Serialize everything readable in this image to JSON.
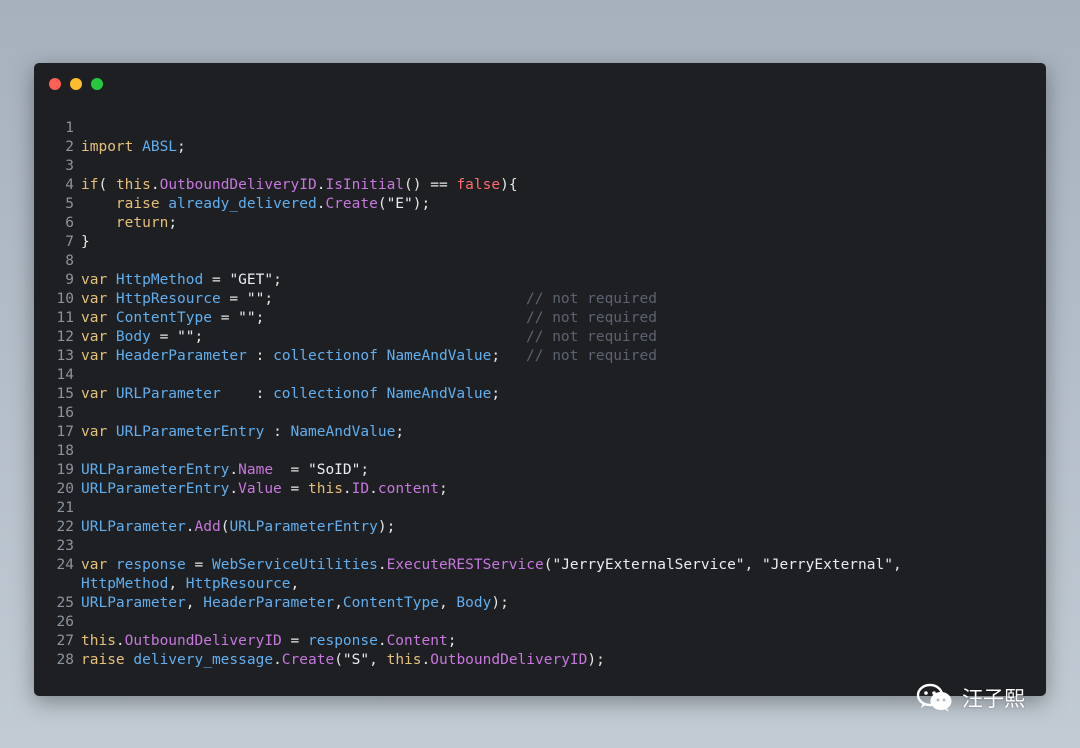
{
  "watermark": {
    "author": "汪子熙",
    "icon": "wechat-icon"
  },
  "window_controls": [
    "close",
    "minimize",
    "maximize"
  ],
  "colors": {
    "keyword": "#e5c07b",
    "identifier": "#61afef",
    "member": "#c678dd",
    "string": "#e9edf1",
    "false": "#ff6b6b",
    "comment": "#5c6370"
  },
  "lines": [
    {
      "n": "1",
      "t": []
    },
    {
      "n": "2",
      "t": [
        [
          "import",
          "kw"
        ],
        [
          " ABSL",
          "pl"
        ],
        [
          ";",
          "op"
        ]
      ]
    },
    {
      "n": "3",
      "t": []
    },
    {
      "n": "4",
      "t": [
        [
          "if",
          "kw"
        ],
        [
          "( ",
          "op"
        ],
        [
          "this",
          "kw"
        ],
        [
          ".",
          "op"
        ],
        [
          "OutboundDeliveryID",
          "mt"
        ],
        [
          ".",
          "op"
        ],
        [
          "IsInitial",
          "mt"
        ],
        [
          "() == ",
          "op"
        ],
        [
          "false",
          "fl"
        ],
        [
          "){",
          "op"
        ]
      ]
    },
    {
      "n": "5",
      "t": [
        [
          "    raise",
          "kw"
        ],
        [
          " already_delivered",
          "pl"
        ],
        [
          ".",
          "op"
        ],
        [
          "Create",
          "mt"
        ],
        [
          "(",
          "op"
        ],
        [
          "\"E\"",
          "st"
        ],
        [
          ");",
          "op"
        ]
      ]
    },
    {
      "n": "6",
      "t": [
        [
          "    return",
          "kw"
        ],
        [
          ";",
          "op"
        ]
      ]
    },
    {
      "n": "7",
      "t": [
        [
          "}",
          "op"
        ]
      ]
    },
    {
      "n": "8",
      "t": []
    },
    {
      "n": "9",
      "t": [
        [
          "var",
          "kw"
        ],
        [
          " HttpMethod",
          "pl"
        ],
        [
          " = ",
          "op"
        ],
        [
          "\"GET\"",
          "st"
        ],
        [
          ";",
          "op"
        ]
      ]
    },
    {
      "n": "10",
      "t": [
        [
          "var",
          "kw"
        ],
        [
          " HttpResource",
          "pl"
        ],
        [
          " = ",
          "op"
        ],
        [
          "\"\"",
          "st"
        ],
        [
          ";",
          "op"
        ]
      ],
      "c": "// not required"
    },
    {
      "n": "11",
      "t": [
        [
          "var",
          "kw"
        ],
        [
          " ContentType",
          "pl"
        ],
        [
          " = ",
          "op"
        ],
        [
          "\"\"",
          "st"
        ],
        [
          ";",
          "op"
        ]
      ],
      "c": "// not required"
    },
    {
      "n": "12",
      "t": [
        [
          "var",
          "kw"
        ],
        [
          " Body",
          "pl"
        ],
        [
          " = ",
          "op"
        ],
        [
          "\"\"",
          "st"
        ],
        [
          ";",
          "op"
        ]
      ],
      "c": "// not required"
    },
    {
      "n": "13",
      "t": [
        [
          "var",
          "kw"
        ],
        [
          " HeaderParameter",
          "pl"
        ],
        [
          " : ",
          "op"
        ],
        [
          "collectionof",
          "pl"
        ],
        [
          " NameAndValue",
          "pl"
        ],
        [
          ";",
          "op"
        ]
      ],
      "c": "// not required"
    },
    {
      "n": "14",
      "t": []
    },
    {
      "n": "15",
      "t": [
        [
          "var",
          "kw"
        ],
        [
          " URLParameter    ",
          "pl"
        ],
        [
          ": ",
          "op"
        ],
        [
          "collectionof",
          "pl"
        ],
        [
          " NameAndValue",
          "pl"
        ],
        [
          ";",
          "op"
        ]
      ]
    },
    {
      "n": "16",
      "t": []
    },
    {
      "n": "17",
      "t": [
        [
          "var",
          "kw"
        ],
        [
          " URLParameterEntry",
          "pl"
        ],
        [
          " : ",
          "op"
        ],
        [
          "NameAndValue",
          "pl"
        ],
        [
          ";",
          "op"
        ]
      ]
    },
    {
      "n": "18",
      "t": []
    },
    {
      "n": "19",
      "t": [
        [
          "URLParameterEntry",
          "pl"
        ],
        [
          ".",
          "op"
        ],
        [
          "Name",
          "mt"
        ],
        [
          "  = ",
          "op"
        ],
        [
          "\"SoID\"",
          "st"
        ],
        [
          ";",
          "op"
        ]
      ]
    },
    {
      "n": "20",
      "t": [
        [
          "URLParameterEntry",
          "pl"
        ],
        [
          ".",
          "op"
        ],
        [
          "Value",
          "mt"
        ],
        [
          " = ",
          "op"
        ],
        [
          "this",
          "kw"
        ],
        [
          ".",
          "op"
        ],
        [
          "ID",
          "mt"
        ],
        [
          ".",
          "op"
        ],
        [
          "content",
          "mt"
        ],
        [
          ";",
          "op"
        ]
      ]
    },
    {
      "n": "21",
      "t": []
    },
    {
      "n": "22",
      "t": [
        [
          "URLParameter",
          "pl"
        ],
        [
          ".",
          "op"
        ],
        [
          "Add",
          "mt"
        ],
        [
          "(",
          "op"
        ],
        [
          "URLParameterEntry",
          "pl"
        ],
        [
          ");",
          "op"
        ]
      ]
    },
    {
      "n": "23",
      "t": []
    },
    {
      "n": "24",
      "t": [
        [
          "var",
          "kw"
        ],
        [
          " response",
          "pl"
        ],
        [
          " = ",
          "op"
        ],
        [
          "WebServiceUtilities",
          "pl"
        ],
        [
          ".",
          "op"
        ],
        [
          "ExecuteRESTService",
          "mt"
        ],
        [
          "(",
          "op"
        ],
        [
          "\"JerryExternalService\"",
          "st"
        ],
        [
          ", ",
          "op"
        ],
        [
          "\"JerryExternal\"",
          "st"
        ],
        [
          ",",
          "op"
        ]
      ]
    },
    {
      "n": "",
      "t": [
        [
          "HttpMethod",
          "pl"
        ],
        [
          ", ",
          "op"
        ],
        [
          "HttpResource",
          "pl"
        ],
        [
          ",",
          "op"
        ]
      ]
    },
    {
      "n": "25",
      "t": [
        [
          "URLParameter",
          "pl"
        ],
        [
          ", ",
          "op"
        ],
        [
          "HeaderParameter",
          "pl"
        ],
        [
          ",",
          "op"
        ],
        [
          "ContentType",
          "pl"
        ],
        [
          ", ",
          "op"
        ],
        [
          "Body",
          "pl"
        ],
        [
          ");",
          "op"
        ]
      ]
    },
    {
      "n": "26",
      "t": []
    },
    {
      "n": "27",
      "t": [
        [
          "this",
          "kw"
        ],
        [
          ".",
          "op"
        ],
        [
          "OutboundDeliveryID",
          "mt"
        ],
        [
          " = ",
          "op"
        ],
        [
          "response",
          "pl"
        ],
        [
          ".",
          "op"
        ],
        [
          "Content",
          "mt"
        ],
        [
          ";",
          "op"
        ]
      ]
    },
    {
      "n": "28",
      "t": [
        [
          "raise",
          "kw"
        ],
        [
          " delivery_message",
          "pl"
        ],
        [
          ".",
          "op"
        ],
        [
          "Create",
          "mt"
        ],
        [
          "(",
          "op"
        ],
        [
          "\"S\"",
          "st"
        ],
        [
          ", ",
          "op"
        ],
        [
          "this",
          "kw"
        ],
        [
          ".",
          "op"
        ],
        [
          "OutboundDeliveryID",
          "mt"
        ],
        [
          ");",
          "op"
        ]
      ]
    }
  ]
}
